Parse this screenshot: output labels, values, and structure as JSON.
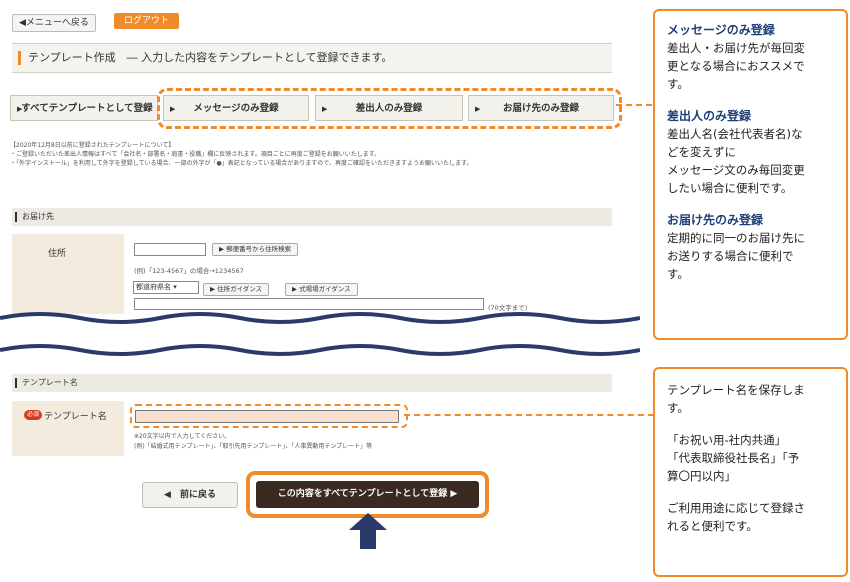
{
  "top_nav": {
    "back_to_menu": "◀メニューへ戻る",
    "logout": "ログアウト"
  },
  "page_title": "テンプレート作成　― 入力した内容をテンプレートとして登録できます。",
  "tabs": [
    {
      "arrow": "▶",
      "label": "すべてテンプレートとして登録"
    },
    {
      "arrow": "▶",
      "label": "メッセージのみ登録"
    },
    {
      "arrow": "▶",
      "label": "差出人のみ登録"
    },
    {
      "arrow": "▶",
      "label": "お届け先のみ登録"
    }
  ],
  "notice": [
    "【2020年12月8日以前に登録されたテンプレートについて】",
    "・ご登録いただいた差出人情報はすべて「会社名・部署名・肩書・役職」欄に反映されます。項目ごとに再度ご登録をお願いいたします。",
    "・「外字インストール」を利用して外字を登録している場合、一部の外字が「●」表記となっている場合がありますので、再度ご確認をいただきますようお願いいたします。"
  ],
  "destination_section": {
    "header": "お届け先",
    "address_label": "住所",
    "zip_search_button": "▶ 郵便番号から住所検索",
    "zip_example": "(例)「123-4567」の場合→1234567",
    "prefecture_select": "都道府県名",
    "address_guide_button": "▶ 住所ガイダンス",
    "venue_guide_button": "▶ 式場場ガイダンス",
    "char_limit": "(70文字まで)"
  },
  "template_name_section": {
    "header": "テンプレート名",
    "required_badge": "必須",
    "label": "テンプレート名",
    "hint1": "※20文字以内で入力してください。",
    "hint2": "(例)「結婚式用テンプレート」、「取引先用テンプレート」、「人事異動用テンプレート」等"
  },
  "buttons": {
    "back": "◀　前に戻る",
    "register_all": "この内容をすべてテンプレートとして登録 ▶"
  },
  "callout_top": [
    {
      "type": "h",
      "text": "メッセージのみ登録"
    },
    {
      "type": "p",
      "text": "差出人・お届け先が毎回変"
    },
    {
      "type": "p",
      "text": "更となる場合におススメで"
    },
    {
      "type": "p",
      "text": "す。"
    },
    {
      "type": "gap",
      "text": ""
    },
    {
      "type": "h",
      "text": "差出人のみ登録"
    },
    {
      "type": "p",
      "text": "差出人名(会社代表者名)な"
    },
    {
      "type": "p",
      "text": "どを変えずに"
    },
    {
      "type": "p",
      "text": "メッセージ文のみ毎回変更"
    },
    {
      "type": "p",
      "text": "したい場合に便利です。"
    },
    {
      "type": "gap",
      "text": ""
    },
    {
      "type": "h",
      "text": "お届け先のみ登録"
    },
    {
      "type": "p",
      "text": "定期的に同一のお届け先に"
    },
    {
      "type": "p",
      "text": "お送りする場合に便利で"
    },
    {
      "type": "p",
      "text": "す。"
    }
  ],
  "callout_bottom": [
    {
      "type": "p",
      "text": "テンプレート名を保存しま"
    },
    {
      "type": "p",
      "text": "す。"
    },
    {
      "type": "gap",
      "text": ""
    },
    {
      "type": "p",
      "text": "「お祝い用-社内共通」"
    },
    {
      "type": "p",
      "text": "「代表取締役社長名」「予"
    },
    {
      "type": "p",
      "text": "算〇円以内」"
    },
    {
      "type": "gap",
      "text": ""
    },
    {
      "type": "p",
      "text": "ご利用用途に応じて登録さ"
    },
    {
      "type": "p",
      "text": "れると便利です。"
    }
  ],
  "colors": {
    "accent_orange": "#f08b2a",
    "wave_navy": "#2b3a6b",
    "dark_button": "#3a2a22",
    "arrow_navy": "#2b3a6b",
    "heading_blue": "#1e3f78"
  },
  "icons": {
    "up_arrow": "up-arrow-icon",
    "wave": "wave-divider"
  }
}
